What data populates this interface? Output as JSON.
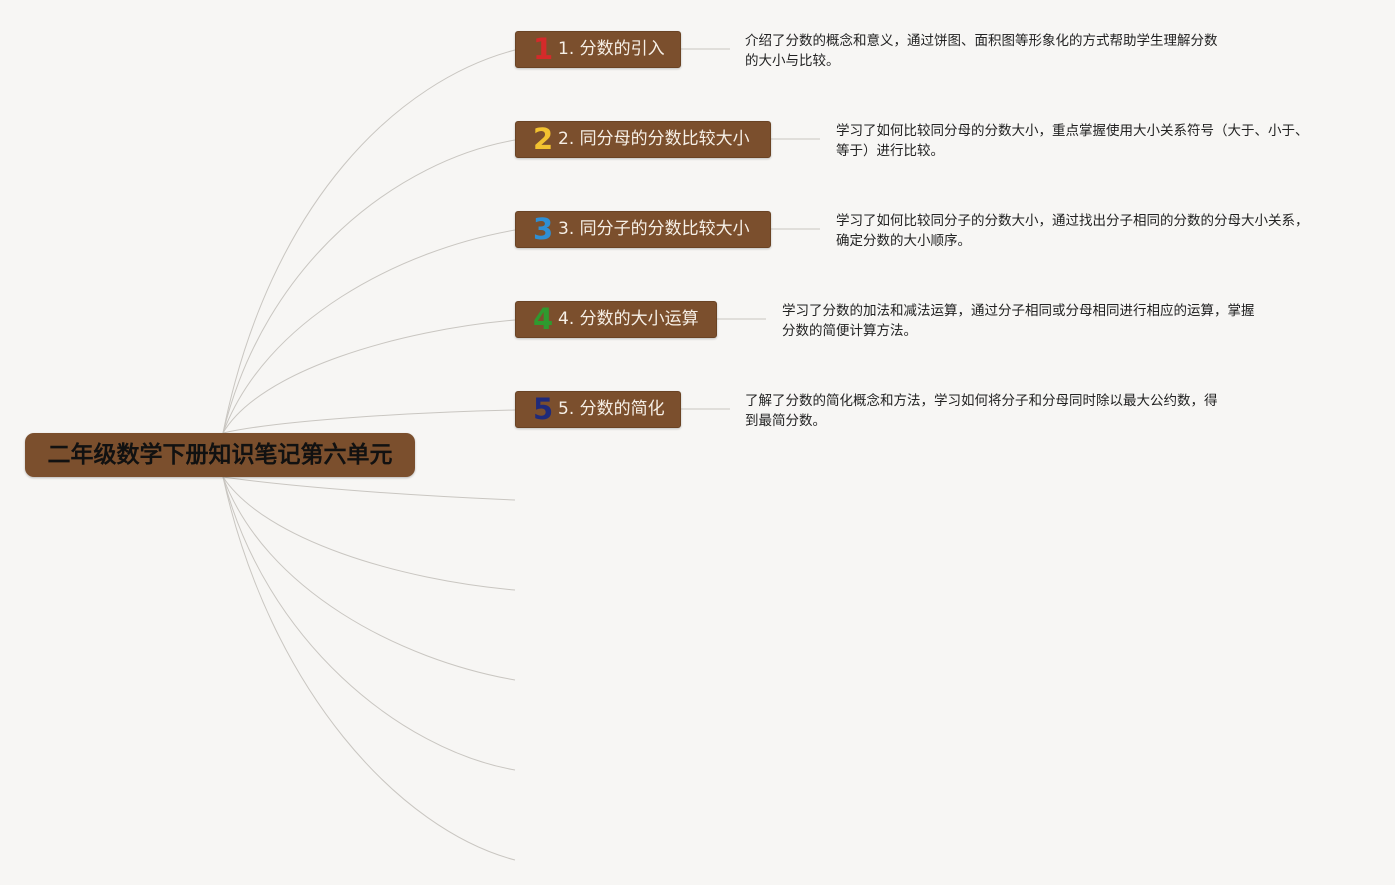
{
  "root": {
    "title": "二年级数学下册知识笔记第六单元"
  },
  "topics": [
    {
      "badge": "1",
      "badge_color": "#d42a2a",
      "label": "1. 分数的引入",
      "desc_line1": "介绍了分数的概念和意义，通过饼图、面积图等形象化的方式帮助学生理解分数",
      "desc_line2": "的大小与比较。"
    },
    {
      "badge": "2",
      "badge_color": "#f2c230",
      "label": "2. 同分母的分数比较大小",
      "desc_line1": "学习了如何比较同分母的分数大小，重点掌握使用大小关系符号（大于、小于、",
      "desc_line2": "等于）进行比较。"
    },
    {
      "badge": "3",
      "badge_color": "#2f8fd4",
      "label": "3. 同分子的分数比较大小",
      "desc_line1": "学习了如何比较同分子的分数大小，通过找出分子相同的分数的分母大小关系，",
      "desc_line2": "确定分数的大小顺序。"
    },
    {
      "badge": "4",
      "badge_color": "#2f9a2f",
      "label": "4. 分数的大小运算",
      "desc_line1": "学习了分数的加法和减法运算，通过分子相同或分母相同进行相应的运算，掌握",
      "desc_line2": "分数的简便计算方法。"
    },
    {
      "badge": "5",
      "badge_color": "#1f2a7a",
      "label": "5. 分数的简化",
      "desc_line1": "了解了分数的简化概念和方法，学习如何将分子和分母同时除以最大公约数，得",
      "desc_line2": "到最简分数。"
    }
  ],
  "colors": {
    "background": "#f7f6f4",
    "node_fill": "#7b4f2d",
    "connector": "#c9c6c1"
  }
}
